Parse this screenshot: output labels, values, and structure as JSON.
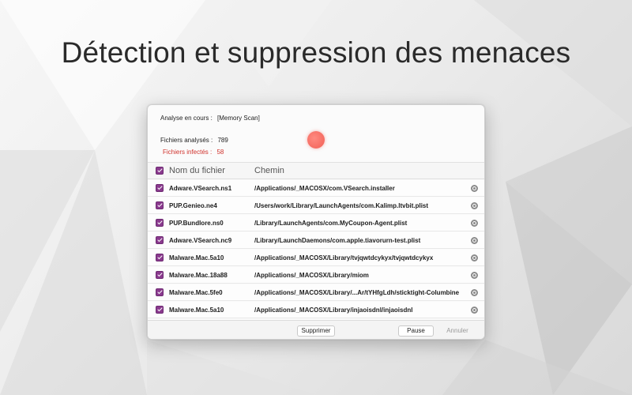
{
  "headline": "Détection et suppression des menaces",
  "status": {
    "scan_label": "Analyse en cours :",
    "scan_value": "[Memory Scan]",
    "files_label": "Fichiers analysés :",
    "files_value": "789",
    "infected_label": "Fichiers infectés :",
    "infected_value": "58"
  },
  "colors": {
    "accent": "#8a3a8e",
    "alert": "#d0322c",
    "indicator": "#f15f55"
  },
  "table": {
    "col_name": "Nom du fichier",
    "col_path": "Chemin",
    "rows": [
      {
        "name": "Adware.VSearch.ns1",
        "path": "/Applications/_MACOSX/com.VSearch.installer"
      },
      {
        "name": "PUP.Genieo.ne4",
        "path": "/Users/work/Library/LaunchAgents/com.Kalimp.ltvbit.plist"
      },
      {
        "name": "PUP.Bundlore.ns0",
        "path": "/Library/LaunchAgents/com.MyCoupon-Agent.plist"
      },
      {
        "name": "Adware.VSearch.nc9",
        "path": "/Library/LaunchDaemons/com.apple.tiavorurn-test.plist"
      },
      {
        "name": "Malware.Mac.5a10",
        "path": "/Applications/_MACOSX/Library/tvjqwtdcykyx/tvjqwtdcykyx"
      },
      {
        "name": "Malware.Mac.18a88",
        "path": "/Applications/_MACOSX/Library/miom"
      },
      {
        "name": "Malware.Mac.5fe0",
        "path": "/Applications/_MACOSX/Library/...Ar/tYHfgLdh/sticktight-Columbine"
      },
      {
        "name": "Malware.Mac.5a10",
        "path": "/Applications/_MACOSX/Library/injaoisdnl/injaoisdnl"
      }
    ]
  },
  "buttons": {
    "delete": "Supprimer",
    "pause": "Pause",
    "cancel": "Annuler"
  },
  "icons": {
    "row_action": "magnifier-icon",
    "check": "checkbox-checked"
  }
}
